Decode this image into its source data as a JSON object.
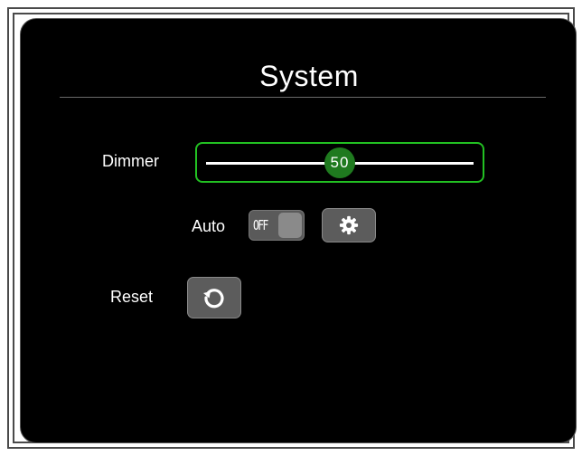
{
  "title": "System",
  "dimmer": {
    "label": "Dimmer",
    "value": 50,
    "value_text": "50",
    "min": 0,
    "max": 100,
    "accent": "#22c022",
    "thumb_color": "#1f7a1f"
  },
  "auto": {
    "label": "Auto",
    "state_text": "OFF",
    "settings_icon": "gear-icon"
  },
  "reset": {
    "label": "Reset",
    "icon": "refresh-icon"
  }
}
